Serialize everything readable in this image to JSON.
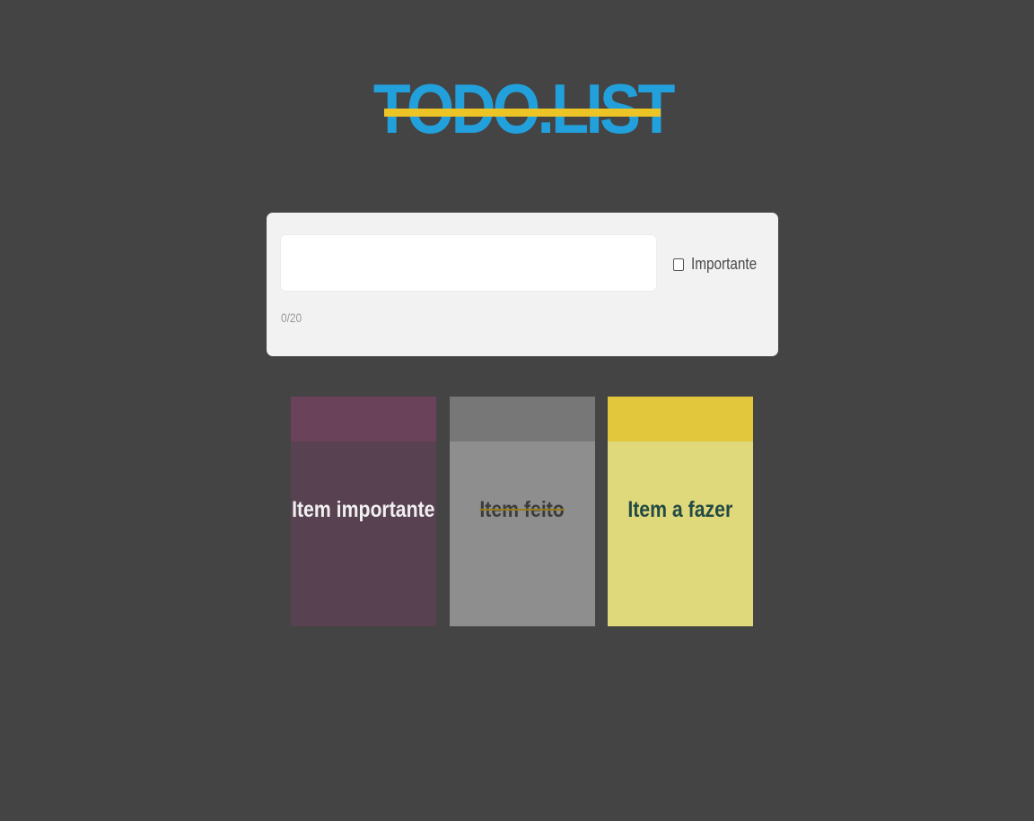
{
  "header": {
    "logo_text": "TODO.LIST"
  },
  "form": {
    "input_value": "",
    "input_placeholder": "",
    "important_label": "Importante",
    "important_checked": false,
    "counter": "0/20"
  },
  "cards": [
    {
      "label": "Item importante",
      "status": "important",
      "top_color": "#6a4259",
      "body_color": "#584150",
      "text_color": "#f0f0f0"
    },
    {
      "label": "Item feito",
      "status": "done",
      "top_color": "#777777",
      "body_color": "#8e8e8e",
      "text_color": "#3c3c3c"
    },
    {
      "label": "Item a fazer",
      "status": "todo",
      "top_color": "#e2c63c",
      "body_color": "#e0d97b",
      "text_color": "#234a44"
    }
  ],
  "colors": {
    "background": "#444444",
    "logo": "#22a0dc",
    "logo_strike": "#ecc426",
    "form_card": "#f2f2f2"
  }
}
